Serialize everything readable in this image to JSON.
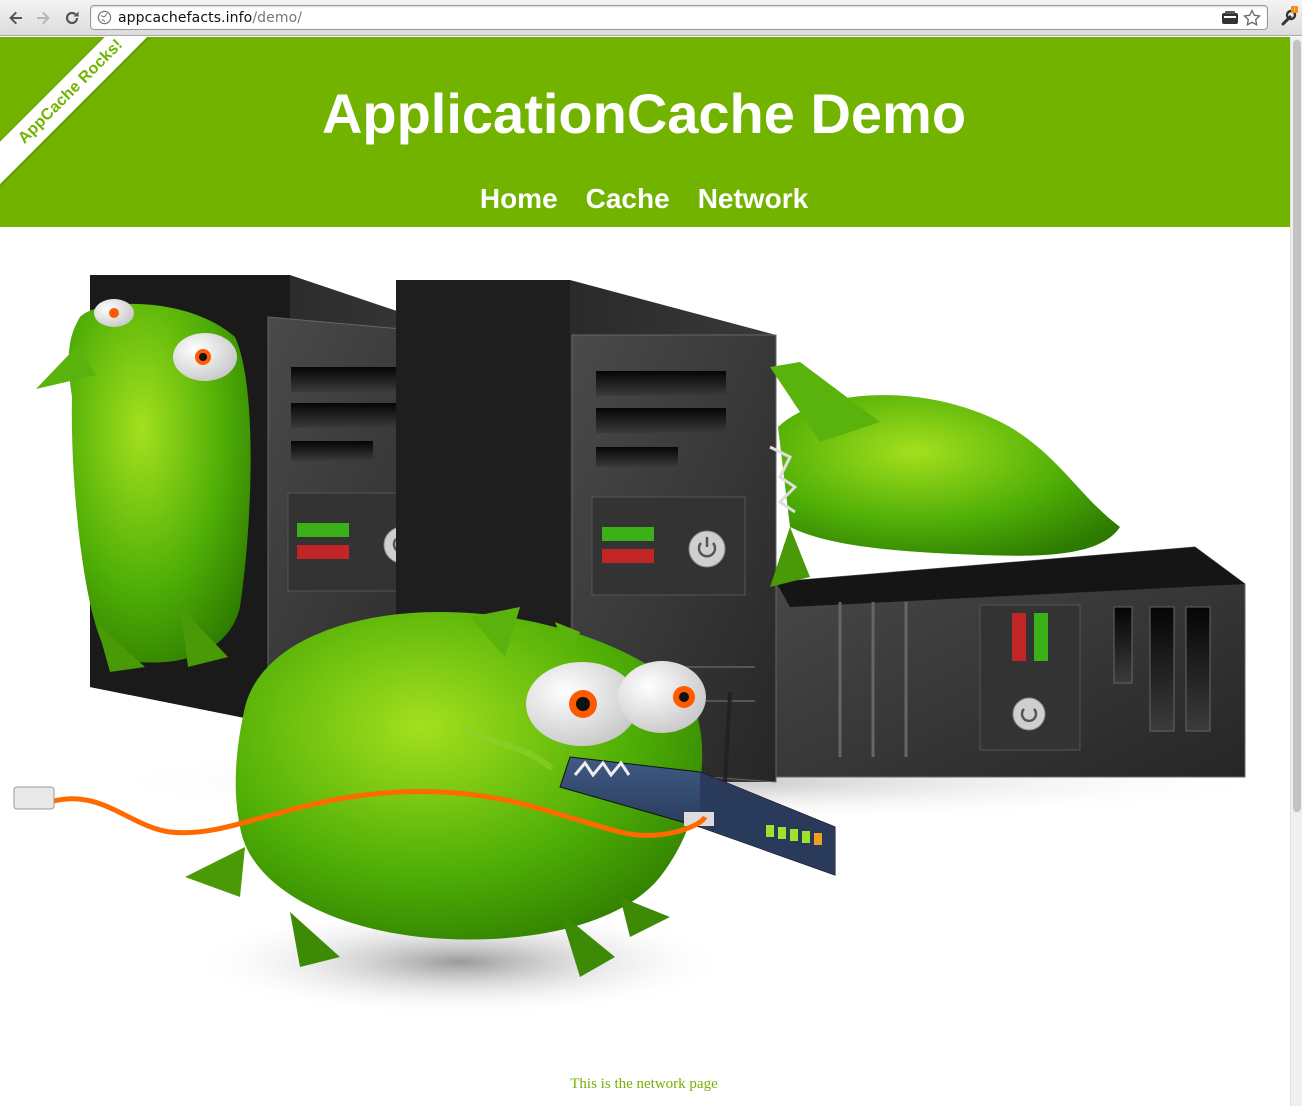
{
  "browser": {
    "url_host": "appcachefacts.info",
    "url_path": "/demo/",
    "icons": [
      "back-icon",
      "forward-icon",
      "reload-icon",
      "globe-icon",
      "page-icon",
      "star-icon",
      "wrench-icon"
    ]
  },
  "header": {
    "title": "ApplicationCache Demo",
    "ribbon": "AppCache Rocks!",
    "nav": [
      {
        "label": "Home"
      },
      {
        "label": "Cache"
      },
      {
        "label": "Network"
      }
    ]
  },
  "content": {
    "message": "This is the network page"
  },
  "colors": {
    "brand_green": "#72b300",
    "monster_green": "#5bb30a",
    "server_dark": "#2b2b2b"
  }
}
